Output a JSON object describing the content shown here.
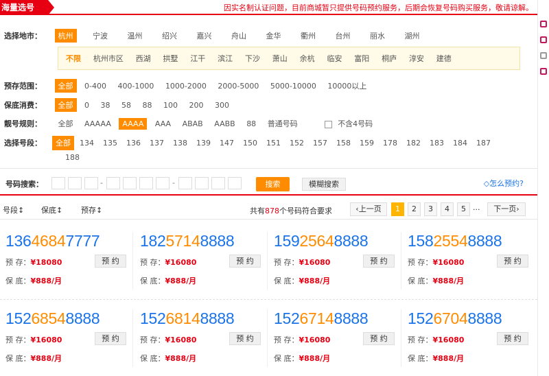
{
  "header": {
    "tab_label": "海量选号",
    "notice": "因实名制认证问题，目前商城暂只提供号码预约服务，后期会恢复号码购买服务，敬请谅解。"
  },
  "filters": {
    "region": {
      "label": "选择地市：",
      "cities": [
        "杭州",
        "宁波",
        "温州",
        "绍兴",
        "嘉兴",
        "舟山",
        "金华",
        "衢州",
        "台州",
        "丽水",
        "湖州"
      ],
      "districts": [
        "不限",
        "杭州市区",
        "西湖",
        "拱墅",
        "江干",
        "滨江",
        "下沙",
        "萧山",
        "余杭",
        "临安",
        "富阳",
        "桐庐",
        "淳安",
        "建德"
      ]
    },
    "deposit": {
      "label": "预存范围：",
      "options": [
        "全部",
        "0-400",
        "400-1000",
        "1000-2000",
        "2000-5000",
        "5000-10000",
        "10000以上"
      ]
    },
    "min_spend": {
      "label": "保底消费：",
      "options": [
        "全部",
        "0",
        "38",
        "58",
        "88",
        "100",
        "200",
        "300"
      ]
    },
    "pattern": {
      "label": "靓号规则：",
      "options": [
        "全部",
        "AAAAA",
        "AAAA",
        "AAA",
        "ABAB",
        "AABB",
        "88",
        "普通号码"
      ],
      "exclude_four": "不含4号码"
    },
    "prefix": {
      "label": "选择号段：",
      "options": [
        "全部",
        "134",
        "135",
        "136",
        "137",
        "138",
        "139",
        "147",
        "150",
        "151",
        "152",
        "157",
        "158",
        "159",
        "178",
        "182",
        "183",
        "184",
        "187",
        "188"
      ]
    }
  },
  "search": {
    "label": "号码搜索：",
    "dash": "-",
    "search_button": "搜索",
    "fuzzy_button": "模糊搜索",
    "howto_link": "怎么预约?"
  },
  "sort": {
    "by_prefix": "号段",
    "by_min_spend": "保底",
    "by_deposit": "预存",
    "total_prefix": "共有",
    "total_count": "878",
    "total_suffix": "个号码符合要求",
    "prev": "上一页",
    "pages": [
      "1",
      "2",
      "3",
      "4",
      "5"
    ],
    "ellipsis": "...",
    "next": "下一页"
  },
  "cards": [
    {
      "pre": "136",
      "mid": "4684",
      "suf": "7777",
      "deposit_label": "预 存：",
      "deposit": "¥18080",
      "min_label": "保 底：",
      "min_spend": "¥888/月",
      "button": "预 约"
    },
    {
      "pre": "182",
      "mid": "5714",
      "suf": "8888",
      "deposit_label": "预 存：",
      "deposit": "¥16080",
      "min_label": "保 底：",
      "min_spend": "¥888/月",
      "button": "预 约"
    },
    {
      "pre": "159",
      "mid": "2564",
      "suf": "8888",
      "deposit_label": "预 存：",
      "deposit": "¥16080",
      "min_label": "保 底：",
      "min_spend": "¥888/月",
      "button": "预 约"
    },
    {
      "pre": "158",
      "mid": "2554",
      "suf": "8888",
      "deposit_label": "预 存：",
      "deposit": "¥16080",
      "min_label": "保 底：",
      "min_spend": "¥888/月",
      "button": "预 约"
    },
    {
      "pre": "152",
      "mid": "6854",
      "suf": "8888",
      "deposit_label": "预 存：",
      "deposit": "¥16080",
      "min_label": "保 底：",
      "min_spend": "¥888/月",
      "button": "预 约"
    },
    {
      "pre": "152",
      "mid": "6814",
      "suf": "8888",
      "deposit_label": "预 存：",
      "deposit": "¥16080",
      "min_label": "保 底：",
      "min_spend": "¥888/月",
      "button": "预 约"
    },
    {
      "pre": "152",
      "mid": "6714",
      "suf": "8888",
      "deposit_label": "预 存：",
      "deposit": "¥16080",
      "min_label": "保 底：",
      "min_spend": "¥888/月",
      "button": "预 约"
    },
    {
      "pre": "152",
      "mid": "6704",
      "suf": "8888",
      "deposit_label": "预 存：",
      "deposit": "¥16080",
      "min_label": "保 底：",
      "min_spend": "¥888/月",
      "button": "预 约"
    }
  ]
}
